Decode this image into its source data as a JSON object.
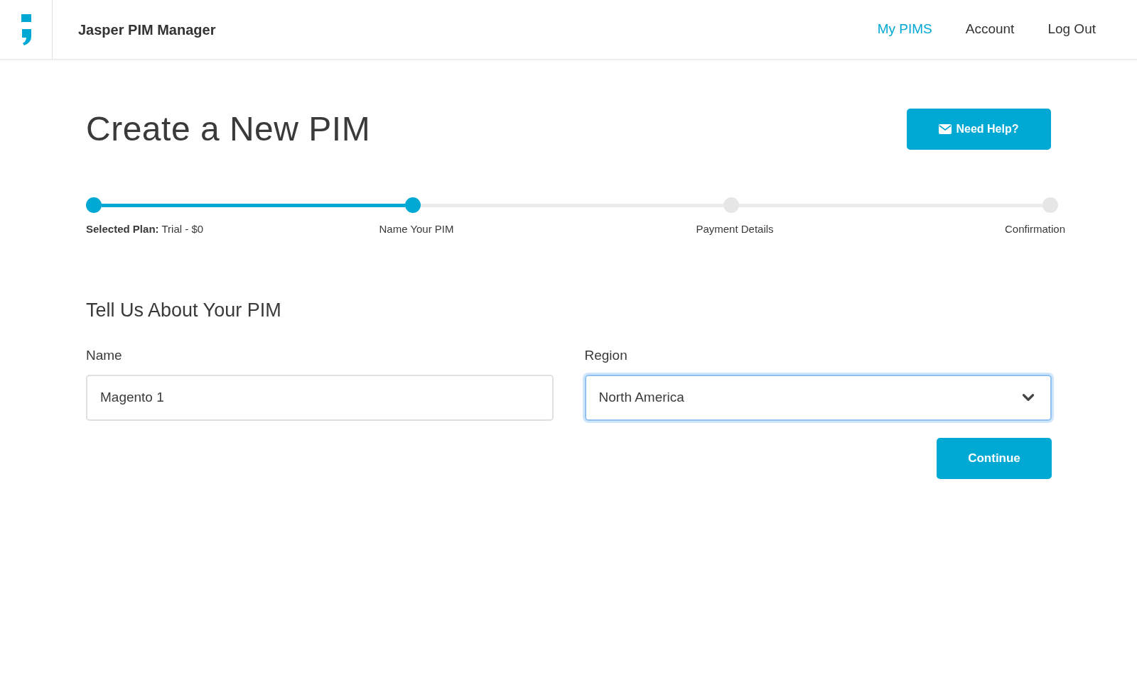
{
  "header": {
    "app_name": "Jasper PIM Manager",
    "nav": [
      {
        "label": "My PIMS",
        "selected": true
      },
      {
        "label": "Account",
        "selected": false
      },
      {
        "label": "Log Out",
        "selected": false
      }
    ]
  },
  "page": {
    "title": "Create a New PIM",
    "help_button": "Need Help?"
  },
  "stepper": [
    {
      "label": "**Selected Plan:** Trial - $0",
      "completed": true
    },
    {
      "label": "Name Your PIM",
      "completed": true
    },
    {
      "label": "Payment Details",
      "completed": false
    },
    {
      "label": "Confirmation",
      "completed": false
    }
  ],
  "form": {
    "heading": "Tell Us About Your PIM",
    "name": {
      "label": "Name",
      "value": "Magento 1"
    },
    "region": {
      "label": "Region",
      "value": "North America",
      "focused": true
    },
    "continue_button": "Continue"
  }
}
